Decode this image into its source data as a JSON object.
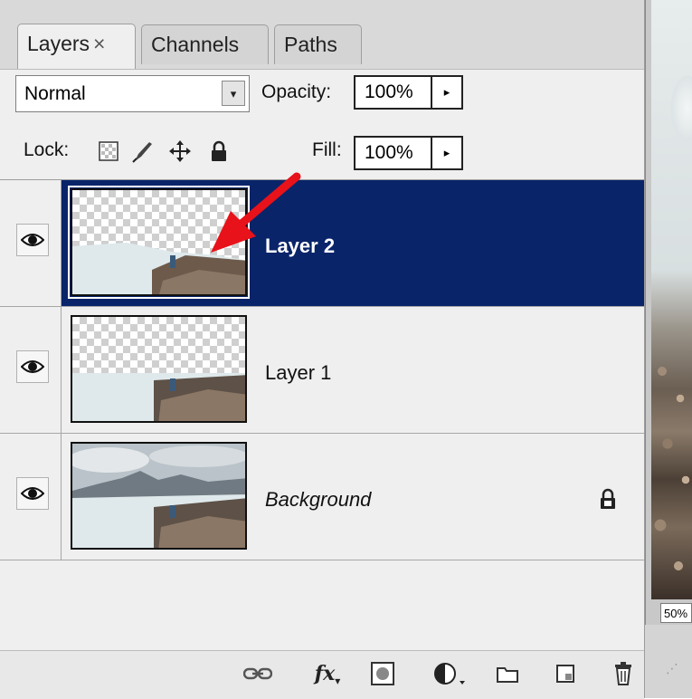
{
  "tabs": [
    {
      "label": "Layers",
      "close": "×"
    },
    {
      "label": "Channels"
    },
    {
      "label": "Paths"
    }
  ],
  "blend_mode": {
    "value": "Normal",
    "arrow": "▾"
  },
  "opacity": {
    "label": "Opacity:",
    "value": "100%",
    "arrow": "▸"
  },
  "lock": {
    "label": "Lock:",
    "icons": [
      "lock-transparent-icon",
      "lock-image-icon",
      "lock-position-icon",
      "lock-all-icon"
    ]
  },
  "fill": {
    "label": "Fill:",
    "value": "100%",
    "arrow": "▸"
  },
  "layers": [
    {
      "name": "Layer 2",
      "selected": true,
      "visible": true
    },
    {
      "name": "Layer 1",
      "selected": false,
      "visible": true
    },
    {
      "name": "Background",
      "selected": false,
      "visible": true,
      "locked": true
    }
  ],
  "document": {
    "zoom": "50%"
  },
  "annotation_color": "#e8121a",
  "selection_color": "#0a246a",
  "footer_icons": [
    "link-layers-icon",
    "fx-icon",
    "add-mask-icon",
    "adjustment-layer-icon",
    "new-group-icon",
    "new-layer-icon",
    "delete-layer-icon"
  ],
  "footer_text": {
    "fx": "fx"
  }
}
